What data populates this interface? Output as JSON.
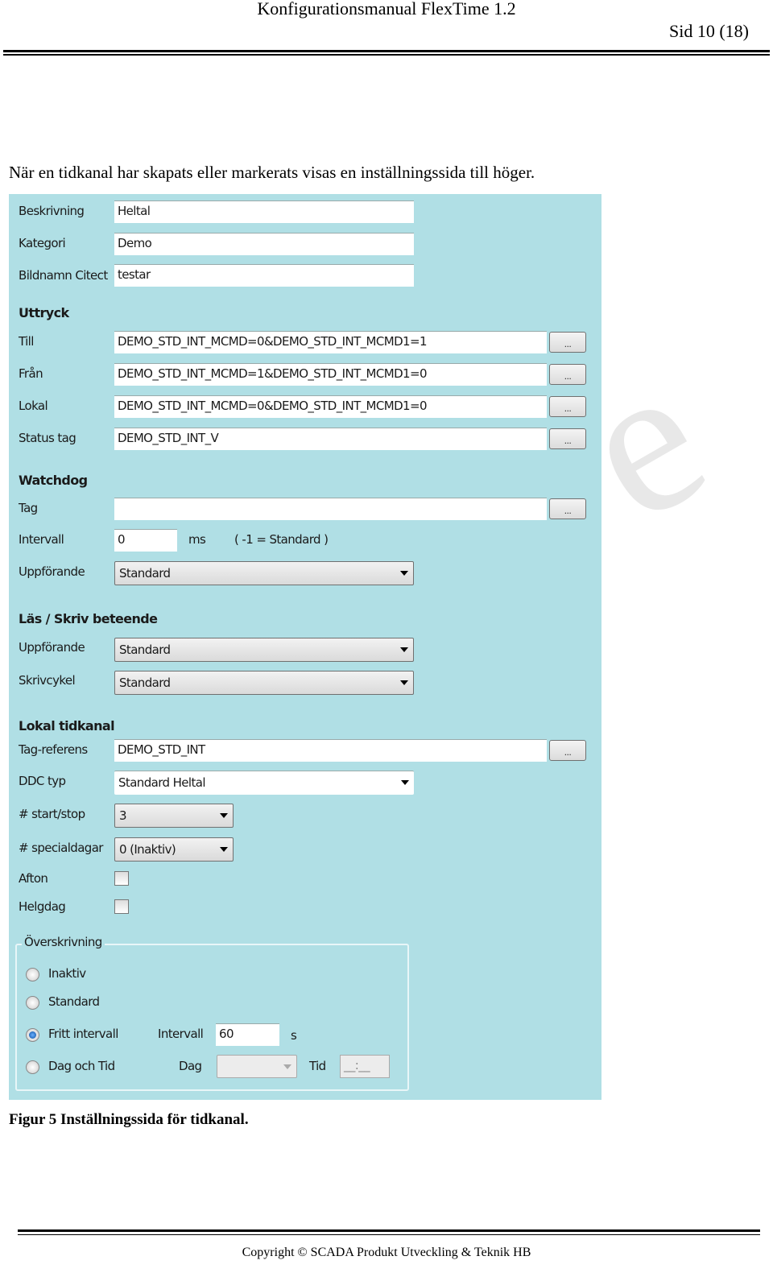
{
  "header": {
    "title": "Konfigurationsmanual FlexTime 1.2",
    "page": "Sid 10 (18)"
  },
  "intro": "När en tidkanal har skapats eller markerats visas en inställningssida till höger.",
  "form": {
    "beskrivning": {
      "label": "Beskrivning",
      "value": "Heltal"
    },
    "kategori": {
      "label": "Kategori",
      "value": "Demo"
    },
    "bildnamn": {
      "label": "Bildnamn Citect",
      "value": "testar"
    },
    "uttryck": {
      "heading": "Uttryck",
      "till": {
        "label": "Till",
        "value": "DEMO_STD_INT_MCMD=0&DEMO_STD_INT_MCMD1=1"
      },
      "fran": {
        "label": "Från",
        "value": "DEMO_STD_INT_MCMD=1&DEMO_STD_INT_MCMD1=0"
      },
      "lokal": {
        "label": "Lokal",
        "value": "DEMO_STD_INT_MCMD=0&DEMO_STD_INT_MCMD1=0"
      },
      "status": {
        "label": "Status tag",
        "value": "DEMO_STD_INT_V"
      }
    },
    "browse_label": "...",
    "watchdog": {
      "heading": "Watchdog",
      "tag": {
        "label": "Tag",
        "value": ""
      },
      "intervall": {
        "label": "Intervall",
        "value": "0",
        "unit": "ms",
        "hint": "( -1 = Standard )"
      },
      "uppforande": {
        "label": "Uppförande",
        "value": "Standard"
      }
    },
    "las_skriv": {
      "heading": "Läs / Skriv beteende",
      "uppforande": {
        "label": "Uppförande",
        "value": "Standard"
      },
      "skrivcykel": {
        "label": "Skrivcykel",
        "value": "Standard"
      }
    },
    "lokal_tidkanal": {
      "heading": "Lokal tidkanal",
      "tagref": {
        "label": "Tag-referens",
        "value": "DEMO_STD_INT"
      },
      "ddc": {
        "label": "DDC typ",
        "value": "Standard Heltal"
      },
      "startstop": {
        "label": "# start/stop",
        "value": "3"
      },
      "special": {
        "label": "# specialdagar",
        "value": "0 (Inaktiv)"
      },
      "afton": {
        "label": "Afton",
        "checked": false
      },
      "helgdag": {
        "label": "Helgdag",
        "checked": false
      }
    },
    "overskrivning": {
      "title": "Överskrivning",
      "options": [
        "Inaktiv",
        "Standard",
        "Fritt intervall",
        "Dag och Tid"
      ],
      "selected": "Fritt intervall",
      "intervall_label": "Intervall",
      "intervall_value": "60",
      "intervall_unit": "s",
      "dag_label": "Dag",
      "dag_value": "",
      "tid_label": "Tid",
      "tid_value": "__:__"
    }
  },
  "caption": "Figur 5 Inställningssida för tidkanal.",
  "footer": "Copyright © SCADA Produkt Utveckling & Teknik HB",
  "colors": {
    "panel": "#b0dfe5"
  }
}
